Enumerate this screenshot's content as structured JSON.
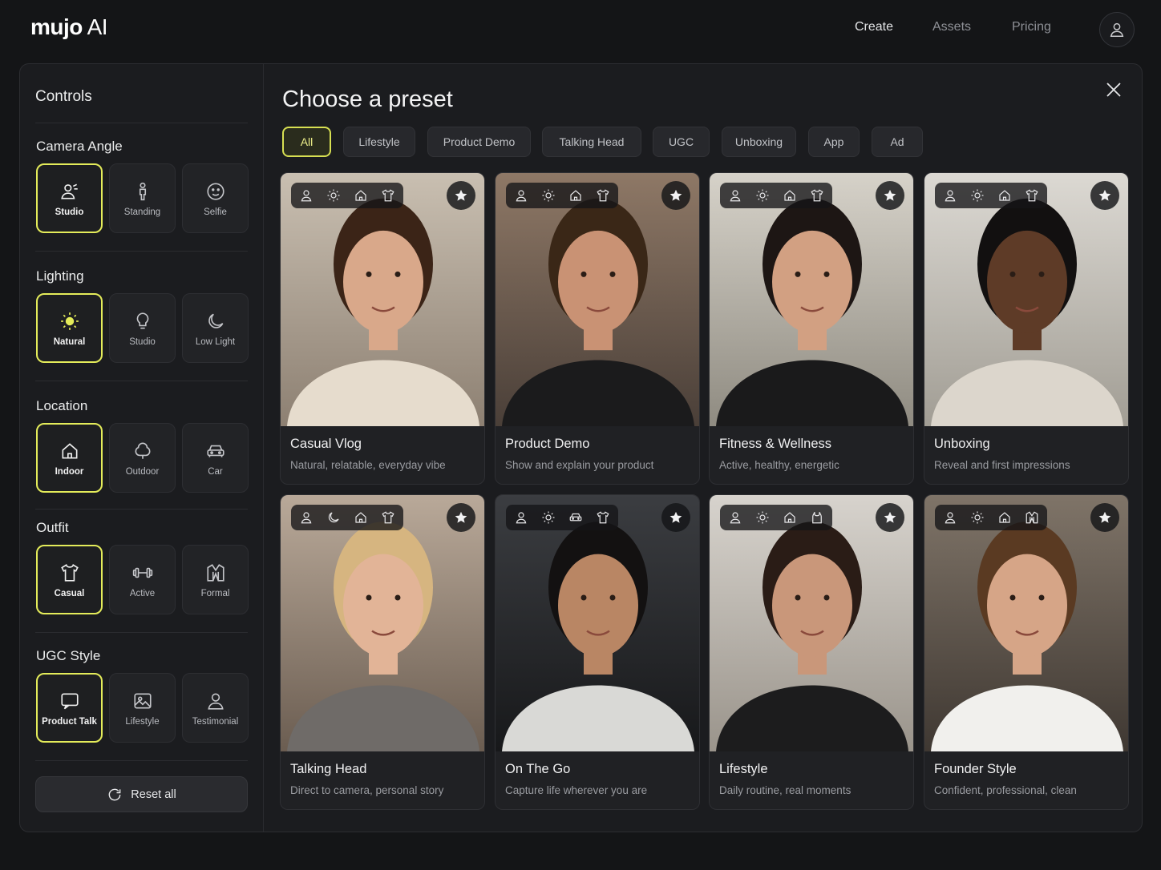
{
  "app": {
    "logo_main": "mujo",
    "logo_ai": " AI"
  },
  "nav": {
    "create": "Create",
    "assets": "Assets",
    "pricing": "Pricing"
  },
  "sidebar": {
    "title": "Controls",
    "groups": [
      {
        "title": "Camera Angle",
        "options": [
          {
            "label": "Studio",
            "icon": "studio-camera-icon",
            "selected": true
          },
          {
            "label": "Standing",
            "icon": "standing-person-icon",
            "selected": false
          },
          {
            "label": "Selfie",
            "icon": "selfie-face-icon",
            "selected": false
          }
        ]
      },
      {
        "title": "Lighting",
        "options": [
          {
            "label": "Natural",
            "icon": "sun-icon",
            "selected": true
          },
          {
            "label": "Studio",
            "icon": "lightbulb-icon",
            "selected": false
          },
          {
            "label": "Low Light",
            "icon": "moon-icon",
            "selected": false
          }
        ]
      },
      {
        "title": "Location",
        "options": [
          {
            "label": "Indoor",
            "icon": "home-icon",
            "selected": true
          },
          {
            "label": "Outdoor",
            "icon": "tree-icon",
            "selected": false
          },
          {
            "label": "Car",
            "icon": "car-icon",
            "selected": false
          }
        ]
      },
      {
        "title": "Outfit",
        "options": [
          {
            "label": "Casual",
            "icon": "tshirt-icon",
            "selected": true
          },
          {
            "label": "Active",
            "icon": "dumbbell-icon",
            "selected": false
          },
          {
            "label": "Formal",
            "icon": "jacket-icon",
            "selected": false
          }
        ]
      },
      {
        "title": "UGC Style",
        "options": [
          {
            "label": "Product Talk",
            "icon": "chat-bubble-icon",
            "selected": true
          },
          {
            "label": "Lifestyle",
            "icon": "image-icon",
            "selected": false
          },
          {
            "label": "Testimonial",
            "icon": "person-icon",
            "selected": false
          }
        ]
      }
    ],
    "reset_label": "Reset all"
  },
  "main": {
    "title": "Choose a preset",
    "filters": [
      "All",
      "Lifestyle",
      "Product Demo",
      "Talking Head",
      "UGC",
      "Unboxing",
      "App",
      "Ad"
    ],
    "active_filter": "All",
    "presets": [
      {
        "title": "Casual Vlog",
        "description": "Natural, relatable, everyday vibe",
        "tags": [
          "person-icon",
          "sun-icon",
          "home-icon",
          "tshirt-icon"
        ]
      },
      {
        "title": "Product Demo",
        "description": "Show and explain your product",
        "tags": [
          "person-icon",
          "sun-icon",
          "home-icon",
          "tshirt-icon"
        ]
      },
      {
        "title": "Fitness & Wellness",
        "description": "Active, healthy, energetic",
        "tags": [
          "person-icon",
          "sun-icon",
          "home-icon",
          "tshirt-icon"
        ]
      },
      {
        "title": "Unboxing",
        "description": "Reveal and first impressions",
        "tags": [
          "person-icon",
          "sun-icon",
          "home-icon",
          "tshirt-icon"
        ]
      },
      {
        "title": "Talking Head",
        "description": "Direct to camera, personal story",
        "tags": [
          "person-icon",
          "moon-icon",
          "home-icon",
          "tshirt-icon"
        ]
      },
      {
        "title": "On The Go",
        "description": "Capture life wherever you are",
        "tags": [
          "person-icon",
          "sun-icon",
          "car-icon",
          "tshirt-icon"
        ]
      },
      {
        "title": "Lifestyle",
        "description": "Daily routine, real moments",
        "tags": [
          "person-icon",
          "sun-icon",
          "home-icon",
          "tanktop-icon"
        ]
      },
      {
        "title": "Founder Style",
        "description": "Confident, professional, clean",
        "tags": [
          "person-icon",
          "sun-icon",
          "home-icon",
          "jacket-icon"
        ]
      }
    ]
  },
  "colors": {
    "accent": "#e4ec5a",
    "background": "#141517",
    "panel": "#1b1c1f"
  }
}
